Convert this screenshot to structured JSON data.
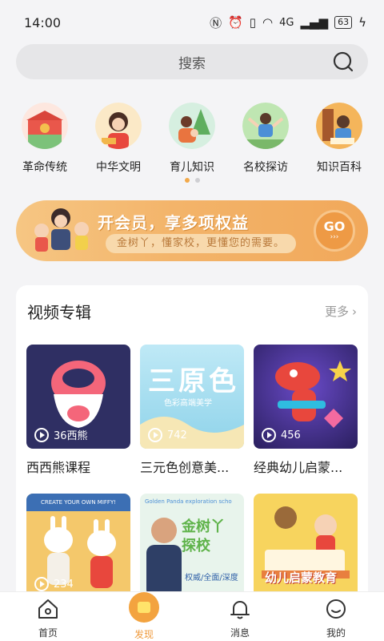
{
  "status_bar": {
    "time": "14:00",
    "network": "4G",
    "battery": "63"
  },
  "search": {
    "placeholder": "搜索"
  },
  "categories": [
    {
      "label": "革命传统",
      "color": "#e9574b"
    },
    {
      "label": "中华文明",
      "color": "#f2b64b"
    },
    {
      "label": "育儿知识",
      "color": "#7cc27a"
    },
    {
      "label": "名校探访",
      "color": "#8fcf86"
    },
    {
      "label": "知识百科",
      "color": "#f4b55b"
    }
  ],
  "banner": {
    "title": "开会员，享多项权益",
    "subtitle": "金树丫，懂家校，更懂您的需要。",
    "button": "GO"
  },
  "album": {
    "title": "视频专辑",
    "more": "更多",
    "items": [
      {
        "label": "西西熊课程",
        "plays": "",
        "thumb_text": "36西熊",
        "bg": "#2f2f63"
      },
      {
        "label": "三元色创意美...",
        "plays": "742",
        "thumb_text": "三原色",
        "thumb_sub": "色彩高端美学",
        "bg": "#8fd3ea"
      },
      {
        "label": "经典幼儿启蒙...",
        "plays": "456",
        "bg": "#3a2b7e"
      },
      {
        "label": "",
        "plays": "234",
        "thumb_text": "CREATE YOUR OWN MIFFY!",
        "bg": "#f4c86b"
      },
      {
        "label": "",
        "plays": "",
        "thumb_text": "金树丫探校",
        "thumb_sub": "权威/全面/深度",
        "thumb_top": "Golden Panda exploration scho",
        "bg": "#e8f4ec"
      },
      {
        "label": "",
        "plays": "",
        "thumb_text": "幼儿启蒙教育",
        "bg": "#f7d45e"
      }
    ]
  },
  "bottom_nav": [
    {
      "label": "首页",
      "icon": "home-icon"
    },
    {
      "label": "发现",
      "icon": "discover-icon",
      "active": true
    },
    {
      "label": "消息",
      "icon": "bell-icon"
    },
    {
      "label": "我的",
      "icon": "profile-icon"
    }
  ]
}
